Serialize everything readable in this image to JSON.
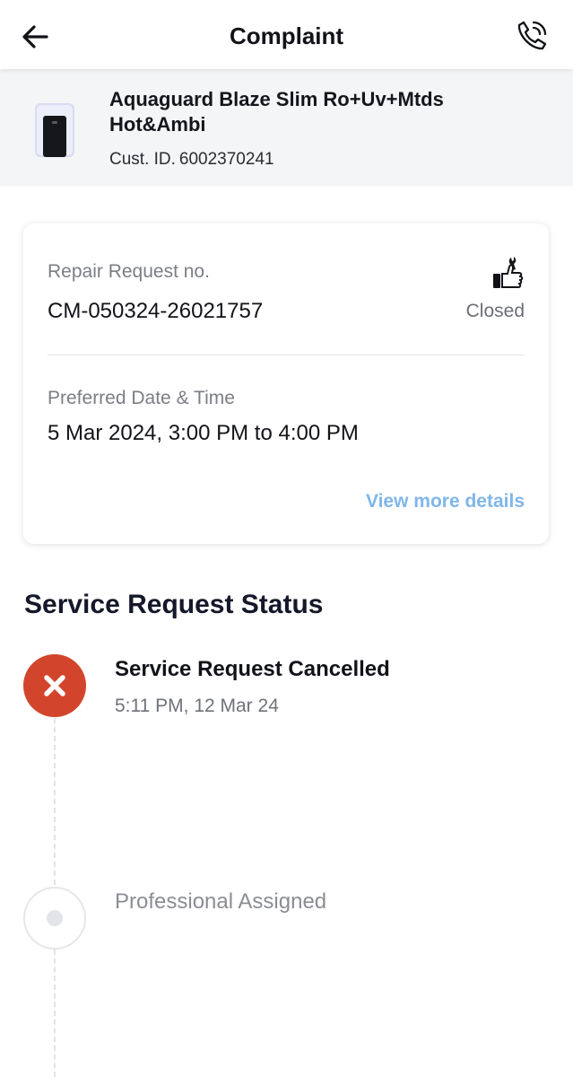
{
  "header": {
    "title": "Complaint",
    "back_icon": "arrow-left-icon",
    "call_icon": "phone-call-icon"
  },
  "product": {
    "name": "Aquaguard Blaze Slim Ro+Uv+Mtds Hot&Ambi",
    "cust_id_label": "Cust. ID.",
    "cust_id": "6002370241"
  },
  "request": {
    "number_label": "Repair Request no.",
    "number": "CM-050324-26021757",
    "status": "Closed",
    "status_icon": "repair-thumbs-up-icon",
    "date_label": "Preferred Date & Time",
    "date_value": "5 Mar 2024, 3:00 PM to 4:00 PM",
    "more_link": "View more details"
  },
  "status_section": {
    "title": "Service Request Status",
    "steps": [
      {
        "title": "Service Request Cancelled",
        "time": "5:11 PM, 12 Mar 24",
        "state": "cancelled"
      },
      {
        "title": "Professional Assigned",
        "time": "",
        "state": "pending"
      }
    ]
  },
  "colors": {
    "cancel": "#d2452c",
    "link": "#7fb6ea",
    "product_bg": "#f4f5f7"
  }
}
